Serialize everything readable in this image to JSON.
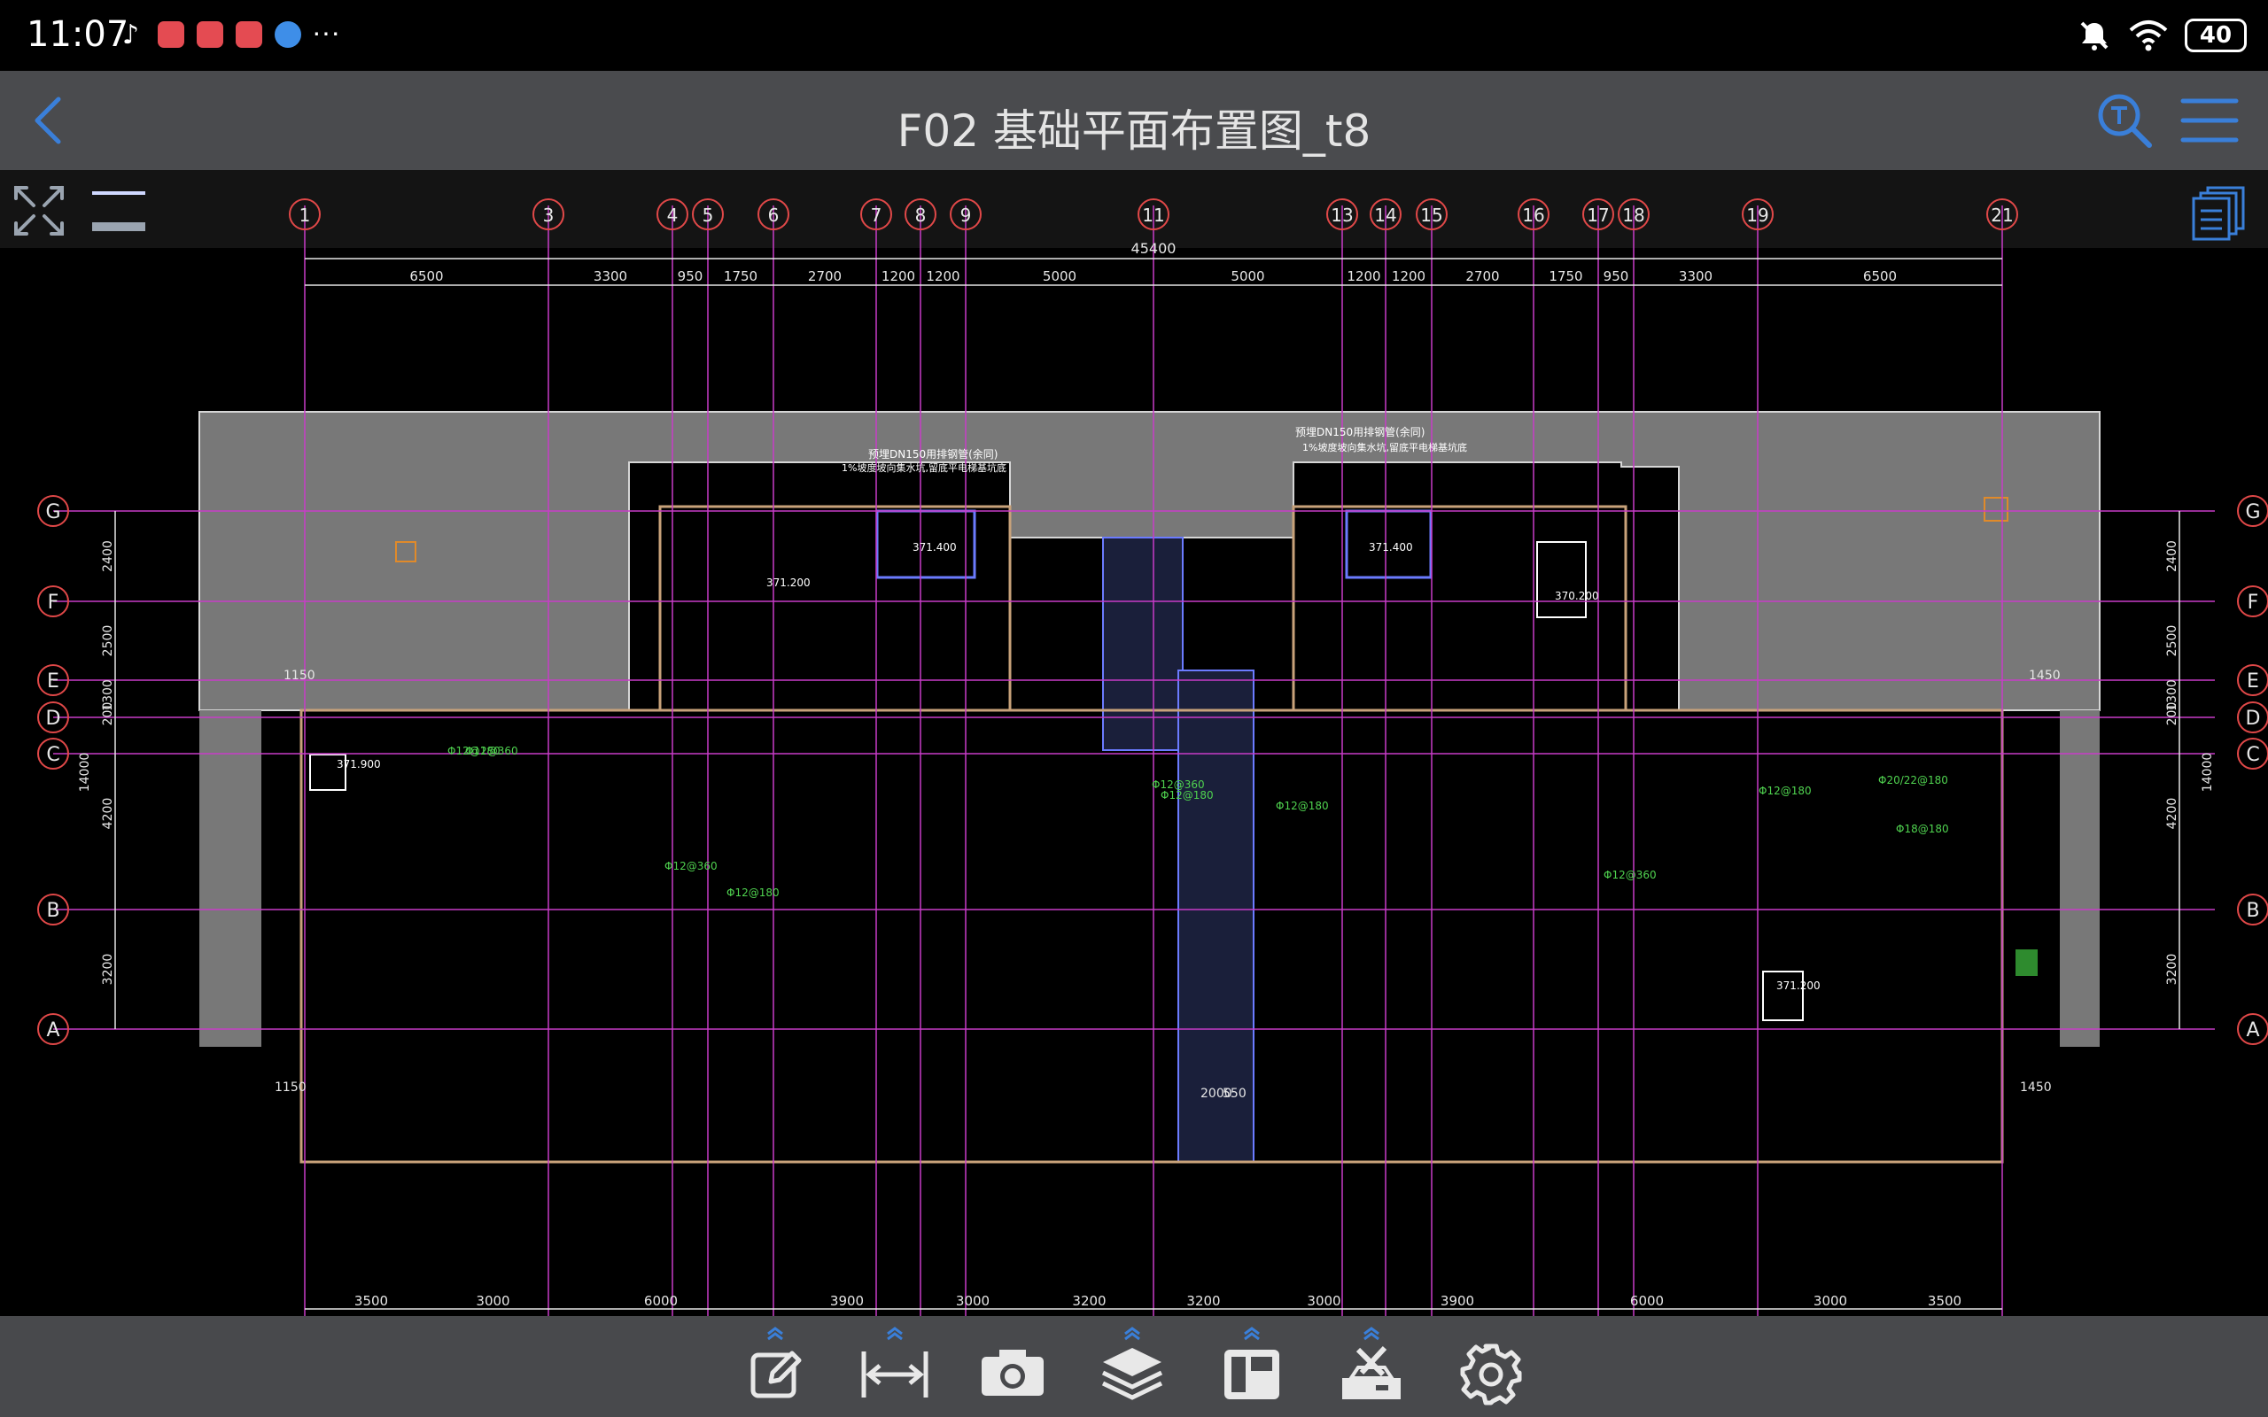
{
  "status_bar": {
    "time": "11:07",
    "more_indicator": "···",
    "battery": "40"
  },
  "header": {
    "title": "F02 基础平面布置图_t8",
    "back_icon": "chevron-left-icon",
    "search_icon": "text-search-icon",
    "menu_icon": "hamburger-menu-icon"
  },
  "drawing": {
    "top_grid_labels": [
      "1",
      "3",
      "4",
      "5",
      "6",
      "7",
      "8",
      "9",
      "11",
      "13",
      "14",
      "15",
      "16",
      "17",
      "18",
      "19",
      "21"
    ],
    "left_grid_labels": [
      "G",
      "F",
      "E",
      "D",
      "C",
      "B",
      "A"
    ],
    "right_grid_labels": [
      "G",
      "F",
      "E",
      "D",
      "C",
      "B",
      "A"
    ],
    "total_dimension": "45400",
    "top_dimensions": [
      "6500",
      "3300",
      "950",
      "1750",
      "2700",
      "1200",
      "1200",
      "5000",
      "5000",
      "1200",
      "1200",
      "2700",
      "1750",
      "950",
      "3300",
      "6500"
    ],
    "bottom_dimensions": [
      "3500",
      "3000",
      "6000",
      "3900",
      "3000",
      "3200",
      "3200",
      "3000",
      "3900",
      "6000",
      "3000",
      "3500"
    ],
    "left_dimensions": [
      "2400",
      "2500",
      "1300",
      "200",
      "4200",
      "3200"
    ],
    "left_total": "14000",
    "right_dimensions": [
      "2400",
      "2500",
      "1300",
      "200",
      "4200",
      "3200"
    ],
    "right_total": "14000",
    "annotations": [
      {
        "text": "预埋DN150用排钢管(余同)"
      },
      {
        "text": "1%坡度坡向集水坑,留底平电梯基坑底"
      },
      {
        "text": "预埋DN150用排钢管(余同)"
      },
      {
        "text": "1%坡度坡向集水坑,留底平电梯基坑底"
      },
      {
        "text": "Φ12@180"
      },
      {
        "text": "Φ12@360"
      },
      {
        "text": "Φ12@180"
      },
      {
        "text": "Φ12@360"
      },
      {
        "text": "Φ12@180"
      },
      {
        "text": "Φ12@360"
      },
      {
        "text": "Φ12@180"
      },
      {
        "text": "Φ20/22@180"
      },
      {
        "text": "Φ18@180"
      },
      {
        "text": "Φ12@180"
      },
      {
        "text": "Φ12@360"
      },
      {
        "text": "371.400"
      },
      {
        "text": "371.400"
      },
      {
        "text": "370.200"
      },
      {
        "text": "371.200"
      },
      {
        "text": "371.900"
      },
      {
        "text": "371.200"
      },
      {
        "text": "2000"
      },
      {
        "text": "550"
      },
      {
        "text": "1450"
      },
      {
        "text": "1150"
      },
      {
        "text": "1150"
      },
      {
        "text": "1450"
      }
    ]
  },
  "toolbar": {
    "tools": [
      {
        "icon": "edit-icon",
        "has_expand": true
      },
      {
        "icon": "measure-icon",
        "has_expand": true
      },
      {
        "icon": "camera-icon",
        "has_expand": false
      },
      {
        "icon": "layers-icon",
        "has_expand": true
      },
      {
        "icon": "layout-icon",
        "has_expand": true
      },
      {
        "icon": "tools-icon",
        "has_expand": true
      },
      {
        "icon": "settings-icon",
        "has_expand": false
      }
    ]
  },
  "colors": {
    "status_bar_bg": "#000000",
    "title_bar_bg": "#4a4b4e",
    "accent_blue": "#3a7fd9",
    "toolbar_bg": "#48494c",
    "grid_line": "#c83cc8",
    "wall": "#c8a27a",
    "dimension": "#e6e6e6",
    "slab_fill": "#7a7a7a",
    "rebar_green": "#4fd24f"
  }
}
